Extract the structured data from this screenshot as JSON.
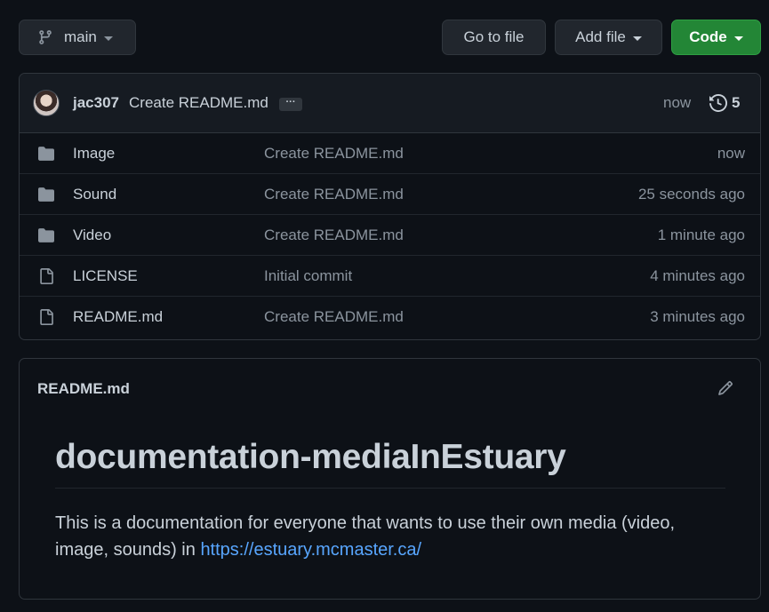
{
  "toolbar": {
    "branch_label": "main",
    "goto_label": "Go to file",
    "add_label": "Add file",
    "code_label": "Code"
  },
  "commit": {
    "author": "jac307",
    "message": "Create README.md",
    "ellipsis": "···",
    "time": "now",
    "history_count": "5"
  },
  "files": [
    {
      "icon": "folder-icon",
      "name": "Image",
      "commit": "Create README.md",
      "time": "now"
    },
    {
      "icon": "folder-icon",
      "name": "Sound",
      "commit": "Create README.md",
      "time": "25 seconds ago"
    },
    {
      "icon": "folder-icon",
      "name": "Video",
      "commit": "Create README.md",
      "time": "1 minute ago"
    },
    {
      "icon": "file-icon",
      "name": "LICENSE",
      "commit": "Initial commit",
      "time": "4 minutes ago"
    },
    {
      "icon": "file-icon",
      "name": "README.md",
      "commit": "Create README.md",
      "time": "3 minutes ago"
    }
  ],
  "readme": {
    "filename": "README.md",
    "heading": "documentation-mediaInEstuary",
    "body_text": "This is a documentation for everyone that wants to use their own media (video, image, sounds) in",
    "link_text": "https://estuary.mcmaster.ca/"
  },
  "colors": {
    "background": "#0d1117",
    "accent_green": "#238636",
    "link_blue": "#58a6ff",
    "muted_text": "#8b949e"
  }
}
